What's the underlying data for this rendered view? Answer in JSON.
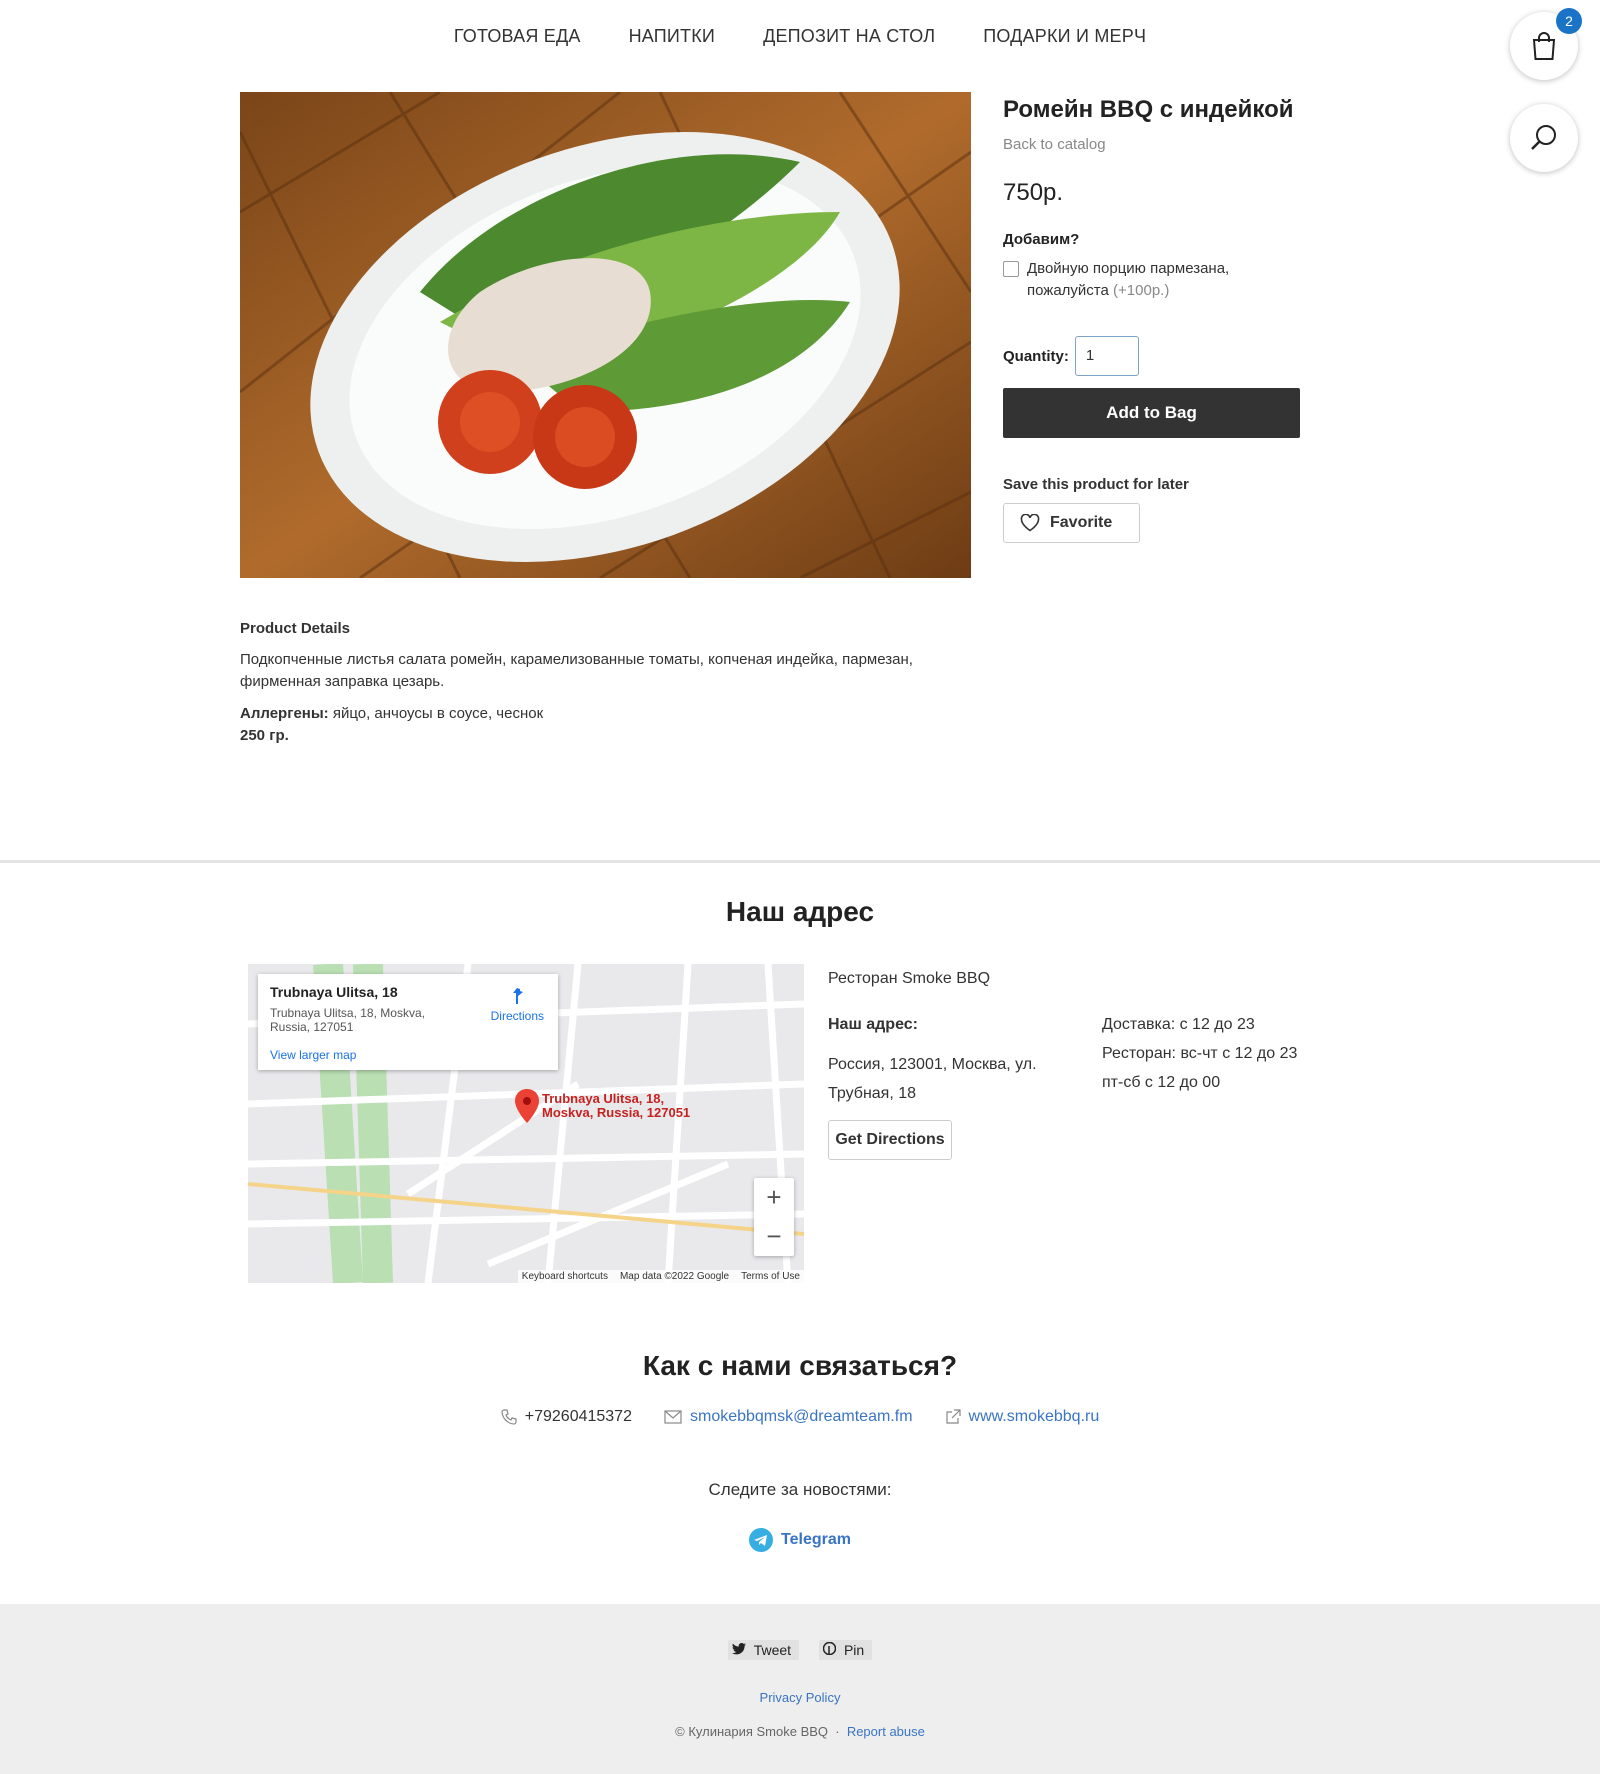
{
  "nav": [
    "ГОТОВАЯ ЕДА",
    "НАПИТКИ",
    "ДЕПОЗИТ НА СТОЛ",
    "ПОДАРКИ И МЕРЧ"
  ],
  "cart": {
    "count": "2"
  },
  "product": {
    "title": "Ромейн BBQ с индейкой",
    "back": "Back to catalog",
    "price": "750р.",
    "addon_question": "Добавим?",
    "addon_label": "Двойную порцию пармезана, пожалуйста",
    "addon_price": "(+100р.)",
    "quantity_label": "Quantity:",
    "quantity_value": "1",
    "add_to_bag": "Add to Bag",
    "save_label": "Save this product for later",
    "favorite": "Favorite"
  },
  "details": {
    "heading": "Product Details",
    "description": "Подкопченные листья салата ромейн, карамелизованные томаты, копченая индейка, пармезан, фирменная заправка цезарь.",
    "allergens_label": "Аллергены:",
    "allergens": "яйцо, анчоусы в соусе, чеснок",
    "weight": "250 гр."
  },
  "location": {
    "heading": "Наш адрес",
    "map_card_title": "Trubnaya Ulitsa, 18",
    "map_card_address": "Trubnaya Ulitsa, 18, Moskva, Russia, 127051",
    "map_card_link": "View larger map",
    "map_directions": "Directions",
    "map_pin_label": "Trubnaya Ulitsa, 18, Moskva, Russia, 127051",
    "map_attrib": [
      "Keyboard shortcuts",
      "Map data ©2022 Google",
      "Terms of Use"
    ],
    "restaurant": "Ресторан Smoke BBQ",
    "address_label": "Наш адрес:",
    "address": "Россия, 123001, Москва, ул. Трубная, 18",
    "hours": [
      "Доставка: с 12 до 23",
      "Ресторан: вс-чт с 12 до 23",
      "пт-сб с 12 до 00"
    ],
    "get_directions": "Get Directions"
  },
  "contact": {
    "heading": "Как с нами связаться?",
    "phone": "+79260415372",
    "email": "smokebbqmsk@dreamteam.fm",
    "website": "www.smokebbq.ru",
    "follow": "Следите за новостями:",
    "telegram": "Telegram"
  },
  "footer": {
    "tweet": "Tweet",
    "pin": "Pin",
    "privacy": "Privacy Policy",
    "copyright": "© Кулинария Smoke BBQ",
    "report": "Report abuse"
  },
  "colors": {
    "accent": "#3a74c4",
    "button_dark": "#333333",
    "badge": "#1b73c7"
  }
}
